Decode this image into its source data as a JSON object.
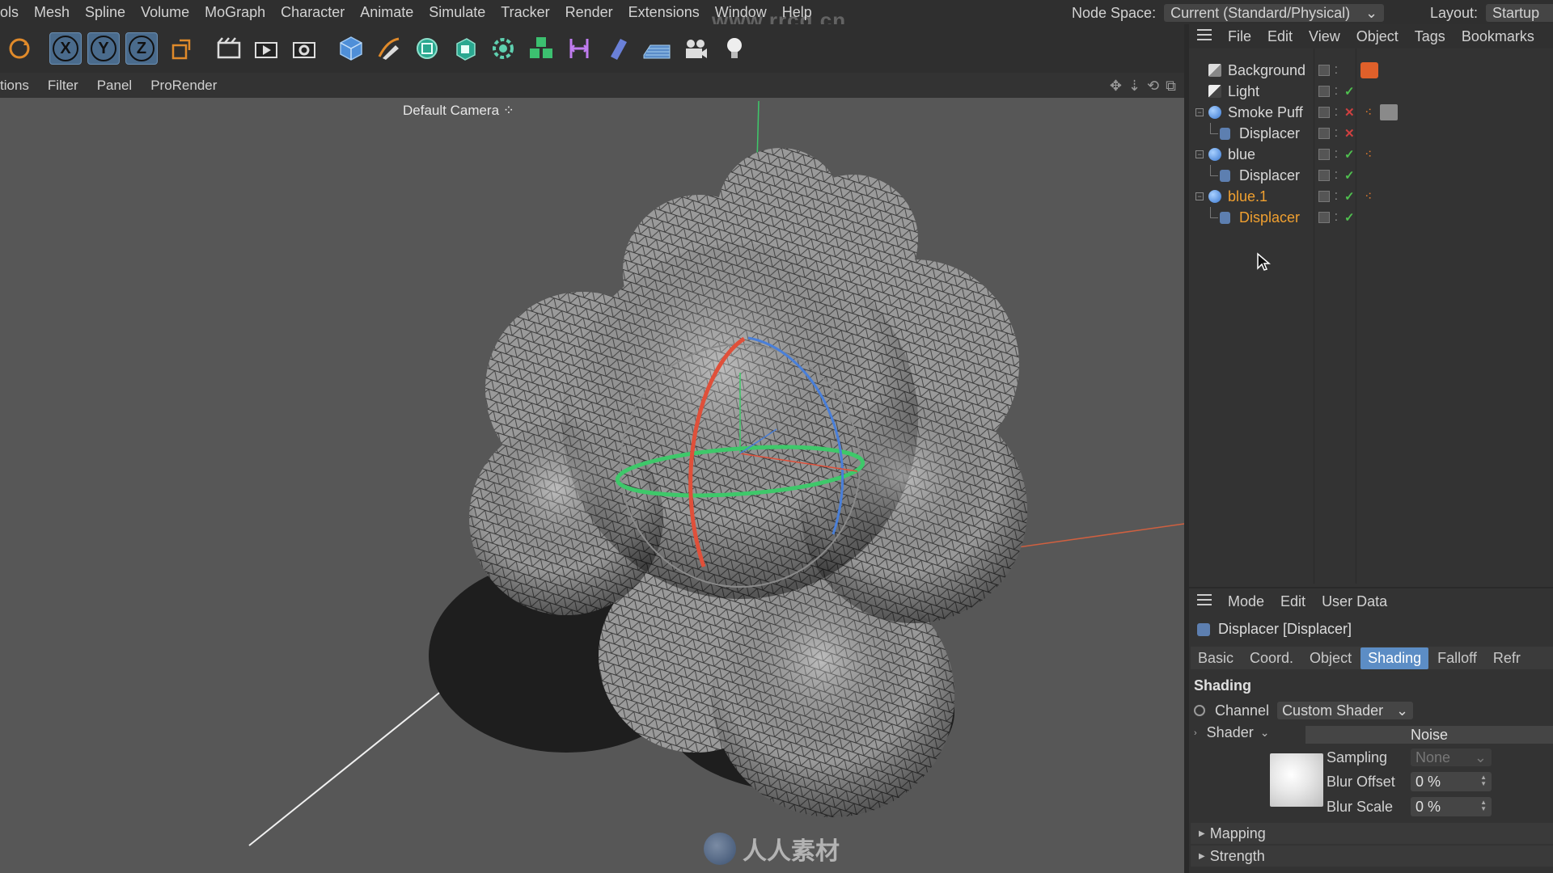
{
  "menubar": {
    "items": [
      "ols",
      "Mesh",
      "Spline",
      "Volume",
      "MoGraph",
      "Character",
      "Animate",
      "Simulate",
      "Tracker",
      "Render",
      "Extensions",
      "Window",
      "Help"
    ],
    "node_space_label": "Node Space:",
    "node_space_value": "Current (Standard/Physical)",
    "layout_label": "Layout:",
    "layout_value": "Startup"
  },
  "toolbar": {
    "axis_x": "X",
    "axis_y": "Y",
    "axis_z": "Z",
    "icons": [
      "rotate-icon",
      "axis-x-icon",
      "axis-y-icon",
      "axis-z-icon",
      "coordinate-system-icon",
      "render-region-icon",
      "render-view-icon",
      "render-settings-icon",
      "cube-icon",
      "pen-icon",
      "subdivision-icon",
      "extrude-icon",
      "cloner-icon",
      "mograph-icon",
      "deformer-icon",
      "field-icon",
      "floor-icon",
      "camera-icon",
      "light-icon"
    ]
  },
  "viewmenu": {
    "items": [
      "tions",
      "Filter",
      "Panel",
      "ProRender"
    ]
  },
  "viewport": {
    "camera_label": "Default Camera"
  },
  "object_manager": {
    "menu": [
      "File",
      "Edit",
      "View",
      "Object",
      "Tags",
      "Bookmarks"
    ],
    "rows": [
      {
        "name": "Background",
        "indent": 0,
        "icon": "background-icon",
        "state": "",
        "tag": "material-tag-orange",
        "highlight": false
      },
      {
        "name": "Light",
        "indent": 0,
        "icon": "light-object-icon",
        "state": "✓",
        "tag": "",
        "highlight": false
      },
      {
        "name": "Smoke Puff",
        "indent": 0,
        "icon": "sphere-icon",
        "state": "✕",
        "tag": "mograph-tag",
        "highlight": false,
        "expandable": true
      },
      {
        "name": "Displacer",
        "indent": 1,
        "icon": "displacer-icon",
        "state": "✕",
        "tag": "",
        "highlight": false
      },
      {
        "name": "blue",
        "indent": 0,
        "icon": "sphere-icon",
        "state": "✓",
        "tag": "mograph-tag",
        "highlight": false,
        "expandable": true
      },
      {
        "name": "Displacer",
        "indent": 1,
        "icon": "displacer-icon",
        "state": "✓",
        "tag": "",
        "highlight": false
      },
      {
        "name": "blue.1",
        "indent": 0,
        "icon": "sphere-icon",
        "state": "✓",
        "tag": "mograph-tag",
        "highlight": true,
        "expandable": true
      },
      {
        "name": "Displacer",
        "indent": 1,
        "icon": "displacer-icon",
        "state": "✓",
        "tag": "",
        "highlight": true
      }
    ]
  },
  "attributes": {
    "menu": [
      "Mode",
      "Edit",
      "User Data"
    ],
    "title": "Displacer [Displacer]",
    "tabs": [
      "Basic",
      "Coord.",
      "Object",
      "Shading",
      "Falloff",
      "Refr"
    ],
    "active_tab": "Shading",
    "section": "Shading",
    "channel_label": "Channel",
    "channel_value": "Custom Shader",
    "shader_label": "Shader",
    "shader_value": "Noise",
    "sampling_label": "Sampling",
    "sampling_value": "None",
    "blur_offset_label": "Blur Offset",
    "blur_offset_value": "0 %",
    "blur_scale_label": "Blur Scale",
    "blur_scale_value": "0 %",
    "folds": [
      "Mapping",
      "Strength"
    ]
  },
  "watermarks": {
    "site": "www.rrcg.cn",
    "logo_text": "人人素材"
  },
  "colors": {
    "accent_blue": "#5c8dc5",
    "highlight_orange": "#f0a030",
    "check_green": "#4fc04f",
    "cross_red": "#d04040",
    "axis_x": "#e0503a",
    "axis_y": "#3ec86a",
    "axis_z": "#4a7fd8"
  }
}
